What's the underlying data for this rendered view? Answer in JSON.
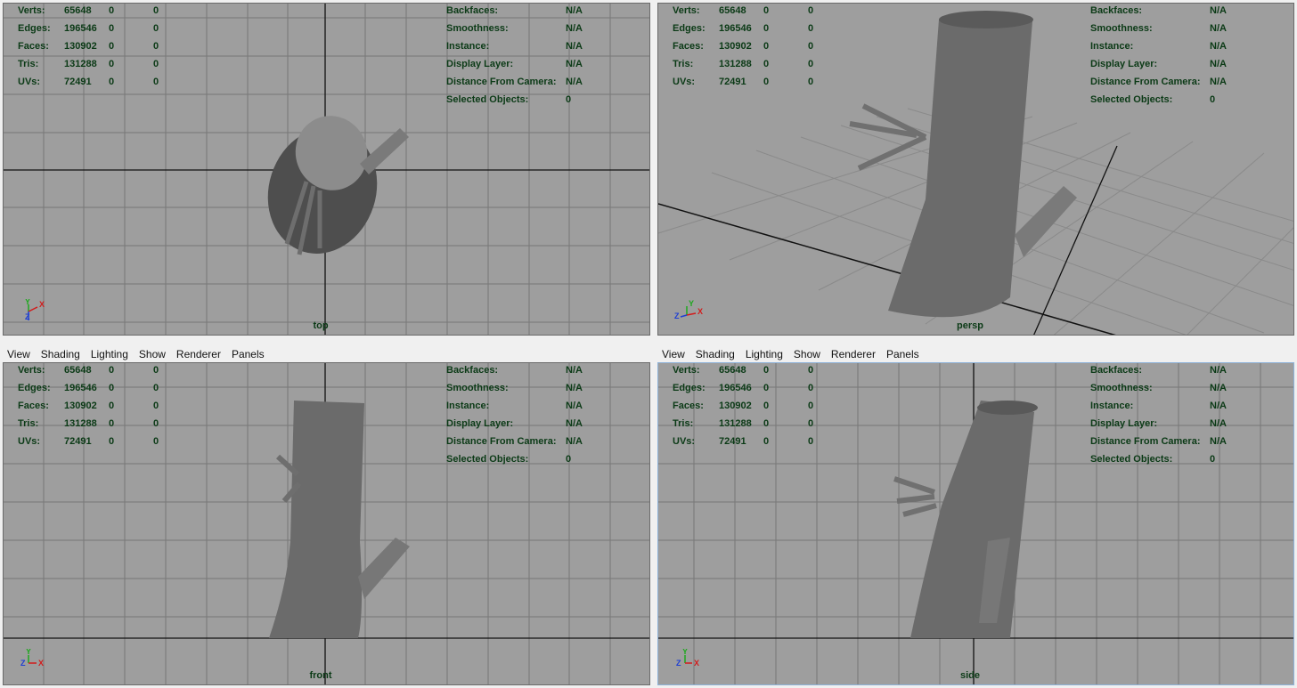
{
  "menu": [
    "View",
    "Shading",
    "Lighting",
    "Show",
    "Renderer",
    "Panels"
  ],
  "hud_left": [
    {
      "label": "Verts:",
      "v1": "65648",
      "v2": "0",
      "v3": "0"
    },
    {
      "label": "Edges:",
      "v1": "196546",
      "v2": "0",
      "v3": "0"
    },
    {
      "label": "Faces:",
      "v1": "130902",
      "v2": "0",
      "v3": "0"
    },
    {
      "label": "Tris:",
      "v1": "131288",
      "v2": "0",
      "v3": "0"
    },
    {
      "label": "UVs:",
      "v1": "72491",
      "v2": "0",
      "v3": "0"
    }
  ],
  "hud_right": [
    {
      "label": "Backfaces:",
      "value": "N/A"
    },
    {
      "label": "Smoothness:",
      "value": "N/A"
    },
    {
      "label": "Instance:",
      "value": "N/A"
    },
    {
      "label": "Display Layer:",
      "value": "N/A"
    },
    {
      "label": "Distance From Camera:",
      "value": "N/A"
    },
    {
      "label": "Selected Objects:",
      "value": "0"
    }
  ],
  "viewports": [
    {
      "camera": "top"
    },
    {
      "camera": "persp"
    },
    {
      "camera": "front"
    },
    {
      "camera": "side"
    }
  ],
  "axis_labels": {
    "x": "X",
    "y": "Y",
    "z": "Z"
  },
  "colors": {
    "viewport_bg": "#9e9e9e",
    "grid_line": "#777777",
    "axis_line": "#111111",
    "hud_text": "#0b3a16",
    "axis_x": "#d21c1c",
    "axis_y": "#1fa81f",
    "axis_z": "#1f3fd2",
    "mesh": "#6b6b6b"
  }
}
